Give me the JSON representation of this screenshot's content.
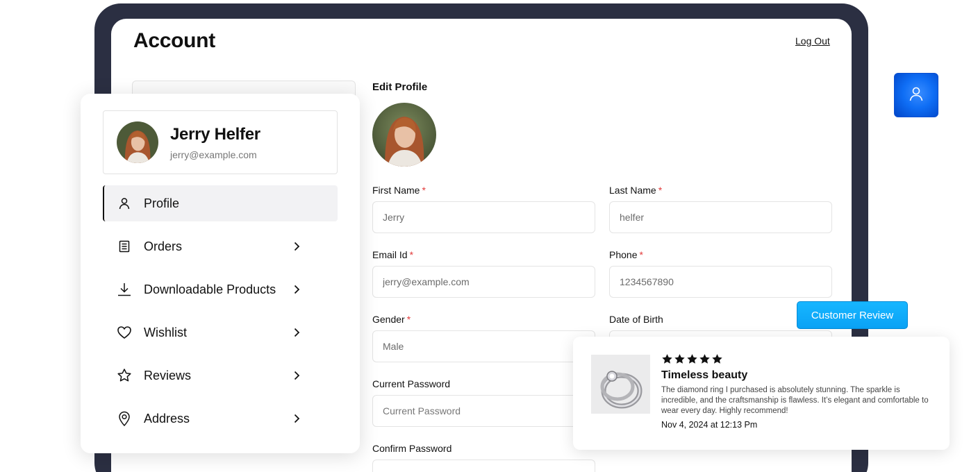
{
  "page": {
    "title": "Account",
    "logout_label": "Log Out"
  },
  "user": {
    "name": "Jerry Helfer",
    "email": "jerry@example.com"
  },
  "sidebar": {
    "items": [
      {
        "label": "Profile",
        "icon": "user-icon",
        "active": true
      },
      {
        "label": "Orders",
        "icon": "orders-icon"
      },
      {
        "label": "Downloadable Products",
        "icon": "download-icon"
      },
      {
        "label": "Wishlist",
        "icon": "heart-icon"
      },
      {
        "label": "Reviews",
        "icon": "star-icon"
      },
      {
        "label": "Address",
        "icon": "location-pin-icon"
      }
    ]
  },
  "form": {
    "title": "Edit Profile",
    "first_name": {
      "label": "First Name",
      "value": "Jerry"
    },
    "last_name": {
      "label": "Last Name",
      "value": "helfer"
    },
    "email": {
      "label": "Email Id",
      "value": "jerry@example.com"
    },
    "phone": {
      "label": "Phone",
      "value": "1234567890"
    },
    "gender": {
      "label": "Gender",
      "value": "Male"
    },
    "dob": {
      "label": "Date of Birth",
      "value": ""
    },
    "current_password": {
      "label": "Current Password",
      "placeholder": "Current Password"
    },
    "confirm_password": {
      "label": "Confirm Password",
      "placeholder": ""
    },
    "required_mark": "*"
  },
  "review": {
    "button_label": "Customer Review",
    "rating": 5,
    "title": "Timeless beauty",
    "body": "The diamond ring I purchased is absolutely stunning. The sparkle is incredible, and the craftsmanship is flawless. It’s elegant and comfortable to wear every day. Highly recommend!",
    "date": "Nov 4, 2024 at 12:13 Pm"
  },
  "colors": {
    "frame": "#2b2f42",
    "accent_blue": "#0f6ef5",
    "review_button": "#0aa2f5",
    "required": "#e23b3b"
  }
}
